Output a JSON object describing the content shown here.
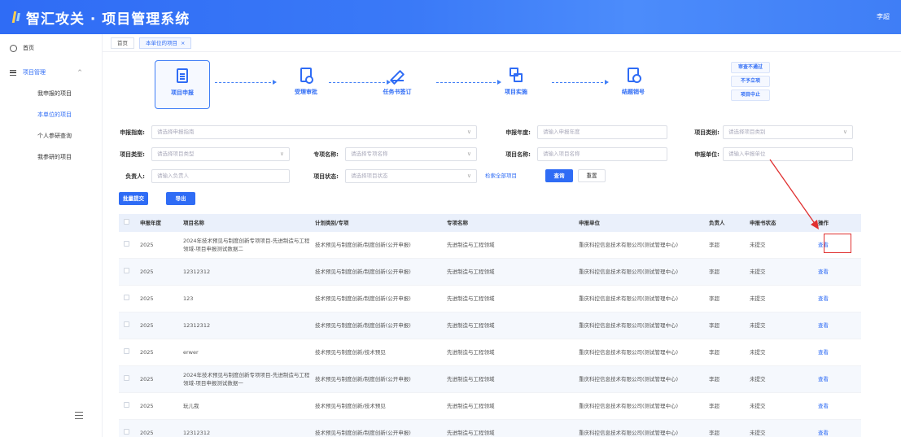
{
  "header": {
    "title": "智汇攻关 · 项目管理系统",
    "user": "李超"
  },
  "sidebar": {
    "home": "首页",
    "group": "项目管理",
    "items": [
      {
        "label": "我申报的项目",
        "active": false
      },
      {
        "label": "本单位的项目",
        "active": true
      },
      {
        "label": "个人参研查询",
        "active": false
      },
      {
        "label": "我参研的项目",
        "active": false
      }
    ]
  },
  "tabs": [
    {
      "label": "首页",
      "active": false
    },
    {
      "label": "本单位的项目",
      "active": true,
      "close": "×"
    }
  ],
  "workflow": {
    "steps": [
      {
        "label": "项目申报",
        "icon": "form-icon",
        "active": true
      },
      {
        "label": "受理审批",
        "icon": "approval-icon",
        "active": false
      },
      {
        "label": "任务书签订",
        "icon": "sign-icon",
        "active": false
      },
      {
        "label": "项目实施",
        "icon": "implement-icon",
        "active": false
      },
      {
        "label": "结题销号",
        "icon": "closing-icon",
        "active": false
      }
    ],
    "side_actions": [
      "审查不通过",
      "不予立项",
      "项目中止"
    ]
  },
  "filters": {
    "guide": {
      "label": "申报指南:",
      "placeholder": "请选择申报指南"
    },
    "year": {
      "label": "申报年度:",
      "placeholder": "请输入申报年度"
    },
    "category": {
      "label": "项目类别:",
      "placeholder": "请选择项目类别"
    },
    "type": {
      "label": "项目类型:",
      "placeholder": "请选择项目类型"
    },
    "special": {
      "label": "专项名称:",
      "placeholder": "请选择专项名称"
    },
    "name": {
      "label": "项目名称:",
      "placeholder": "请输入项目名称"
    },
    "unit": {
      "label": "申报单位:",
      "placeholder": "请输入申报单位"
    },
    "owner": {
      "label": "负责人:",
      "placeholder": "请输入负责人"
    },
    "status": {
      "label": "项目状态:",
      "placeholder": "请选择项目状态"
    },
    "all_link": "检索全部项目",
    "search_btn": "查询",
    "reset_btn": "重置"
  },
  "actions": {
    "batch_submit": "批量提交",
    "export": "导出"
  },
  "table": {
    "columns": [
      "申报年度",
      "项目名称",
      "计划类别/专项",
      "专项名称",
      "申报单位",
      "负责人",
      "申报书状态",
      "操作"
    ],
    "rows": [
      {
        "year": "2025",
        "name": "2024年技术预见与制度创新专项项目-先进制造与工程领域-项目申报测试数据二",
        "plan": "技术预见与制度创新/制度创新(公开申报)",
        "spec": "先进制造与工程领域",
        "unit": "重庆科控信息技术有限公司(测试管理中心)",
        "owner": "李超",
        "status": "未提交",
        "op": "查看"
      },
      {
        "year": "2025",
        "name": "12312312",
        "plan": "技术预见与制度创新/制度创新(公开申报)",
        "spec": "先进制造与工程领域",
        "unit": "重庆科控信息技术有限公司(测试管理中心)",
        "owner": "李超",
        "status": "未提交",
        "op": "查看"
      },
      {
        "year": "2025",
        "name": "123",
        "plan": "技术预见与制度创新/制度创新(公开申报)",
        "spec": "先进制造与工程领域",
        "unit": "重庆科控信息技术有限公司(测试管理中心)",
        "owner": "李超",
        "status": "未提交",
        "op": "查看"
      },
      {
        "year": "2025",
        "name": "12312312",
        "plan": "技术预见与制度创新/制度创新(公开申报)",
        "spec": "先进制造与工程领域",
        "unit": "重庆科控信息技术有限公司(测试管理中心)",
        "owner": "李超",
        "status": "未提交",
        "op": "查看"
      },
      {
        "year": "2025",
        "name": "erwer",
        "plan": "技术预见与制度创新/技术预见",
        "spec": "先进制造与工程领域",
        "unit": "重庆科控信息技术有限公司(测试管理中心)",
        "owner": "李超",
        "status": "未提交",
        "op": "查看"
      },
      {
        "year": "2025",
        "name": "2024年技术预见与制度创新专项项目-先进制造与工程领域-项目申报测试数据一",
        "plan": "技术预见与制度创新/制度创新(公开申报)",
        "spec": "先进制造与工程领域",
        "unit": "重庆科控信息技术有限公司(测试管理中心)",
        "owner": "李超",
        "status": "未提交",
        "op": "查看"
      },
      {
        "year": "2025",
        "name": "玩儿我",
        "plan": "技术预见与制度创新/技术预见",
        "spec": "先进制造与工程领域",
        "unit": "重庆科控信息技术有限公司(测试管理中心)",
        "owner": "李超",
        "status": "未提交",
        "op": "查看"
      },
      {
        "year": "2025",
        "name": "12312312",
        "plan": "技术预见与制度创新/制度创新(公开申报)",
        "spec": "先进制造与工程领域",
        "unit": "重庆科控信息技术有限公司(测试管理中心)",
        "owner": "李超",
        "status": "未提交",
        "op": "查看"
      }
    ]
  },
  "colors": {
    "accent": "#2f6cf5",
    "highlight": "#e03030"
  }
}
